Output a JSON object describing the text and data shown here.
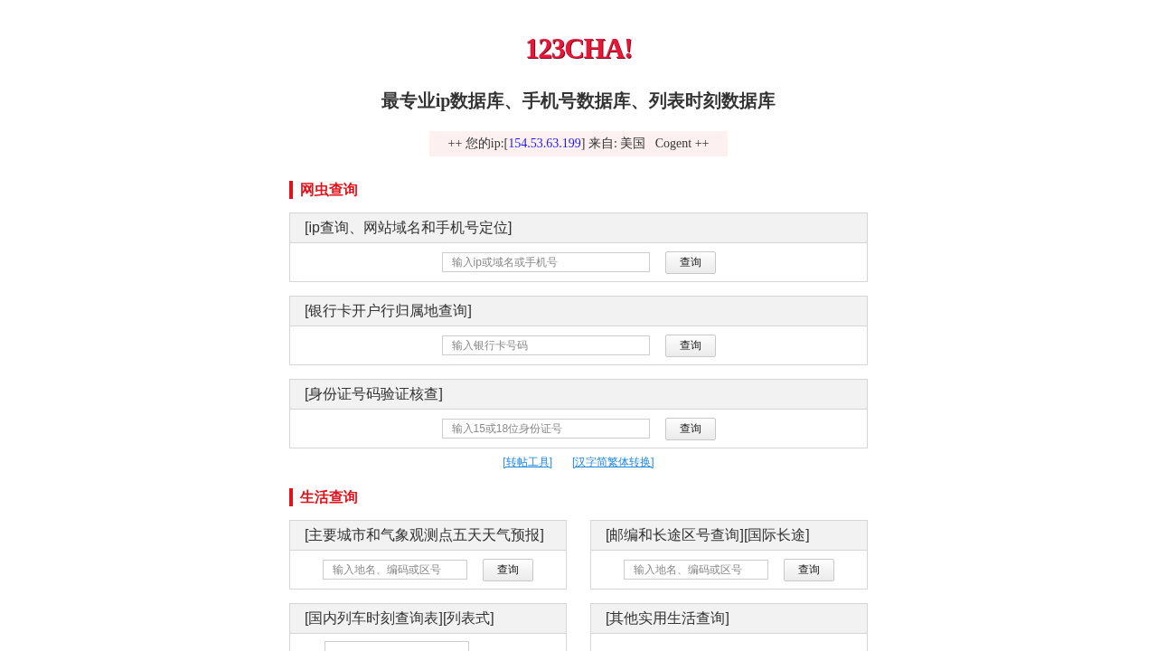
{
  "logo": "123CHA!",
  "headline": "最专业ip数据库、手机号数据库、列表时刻数据库",
  "ip_banner": {
    "prefix": "++ 您的ip:[",
    "ip": "154.53.63.199",
    "suffix": "] 来自: 美国   Cogent ++"
  },
  "sections": [
    {
      "title": "网虫查询",
      "kind": "stack",
      "cards": [
        {
          "title": "[ip查询、网站域名和手机号定位]",
          "kind": "search",
          "placeholder": "输入ip或域名或手机号",
          "button": "查询"
        },
        {
          "title": "[银行卡开户行归属地查询]",
          "kind": "search",
          "placeholder": "输入银行卡号码",
          "button": "查询"
        },
        {
          "title": "[身份证号码验证核查]",
          "kind": "search",
          "placeholder": "输入15或18位身份证号",
          "button": "查询"
        }
      ],
      "links": [
        "[转帖工具]",
        "[汉字简繁体转换]"
      ]
    },
    {
      "title": "生活查询",
      "kind": "grid",
      "cards": [
        {
          "title": "[主要城市和气象观测点五天天气预报]",
          "kind": "search",
          "placeholder": "输入地名、编码或区号",
          "button": "查询"
        },
        {
          "title": "[邮编和长途区号查询][国际长途]",
          "kind": "search",
          "placeholder": "输入地名、编码或区号",
          "button": "查询"
        },
        {
          "title": "[国内列车时刻查询表][列表式]",
          "kind": "input"
        },
        {
          "title": "[其他实用生活查询]",
          "kind": "empty"
        }
      ]
    }
  ]
}
